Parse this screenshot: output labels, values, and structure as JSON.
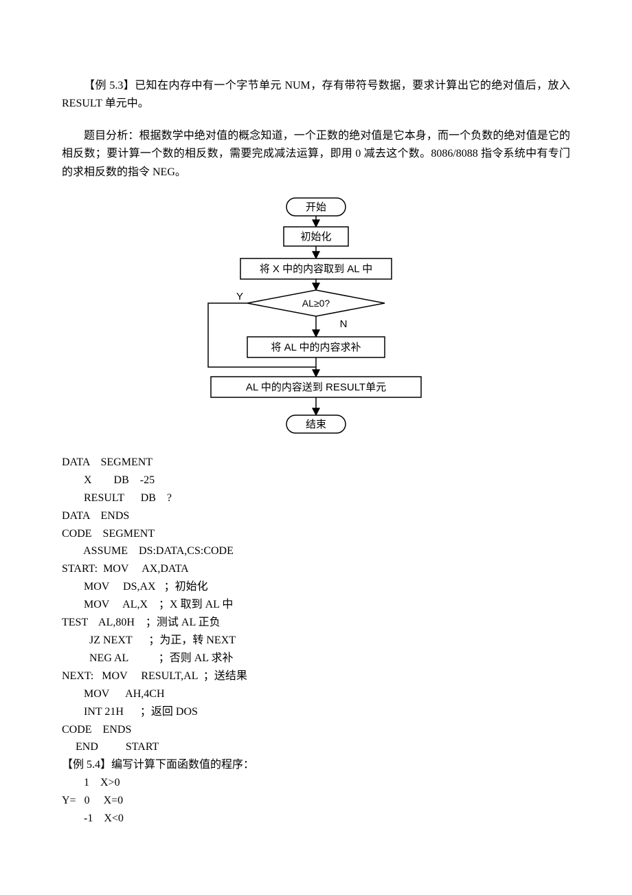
{
  "paras": {
    "p1": "【例 5.3】已知在内存中有一个字节单元 NUM，存有带符号数据，要求计算出它的绝对值后，放入 RESULT 单元中。",
    "p2": "题目分析：根据数学中绝对值的概念知道，一个正数的绝对值是它本身，而一个负数的绝对值是它的相反数；要计算一个数的相反数，需要完成减法运算，即用 0 减去这个数。8086/8088 指令系统中有专门的求相反数的指令 NEG。"
  },
  "flowchart": {
    "start": "开始",
    "init": "初始化",
    "load": "将 X 中的内容取到 AL 中",
    "test": "AL≥0?",
    "yes": "Y",
    "no": "N",
    "neg": "将 AL 中的内容求补",
    "store": "AL 中的内容送到 RESULT单元",
    "end": "结束"
  },
  "code": {
    "l01": "DATA    SEGMENT",
    "l02": "        X        DB    -25",
    "l03": "        RESULT      DB    ?",
    "l04": "DATA    ENDS",
    "l05": "CODE    SEGMENT",
    "l06": "        ASSUME    DS:DATA,CS:CODE",
    "l07": "START:  MOV     AX,DATA",
    "l08": "        MOV     DS,AX   ；初始化",
    "l09": "        MOV     AL,X    ；X 取到 AL 中",
    "l10": "TEST    AL,80H    ；测试 AL 正负",
    "l11": "          JZ NEXT      ；为正，转 NEXT",
    "l12": "          NEG AL           ；否则 AL 求补",
    "l13": "NEXT:   MOV     RESULT,AL  ；送结果",
    "l14": "        MOV      AH,4CH",
    "l15": "        INT 21H      ；返回 DOS",
    "l16": "CODE    ENDS",
    "l17": "     END          START"
  },
  "example54": {
    "title": "【例 5.4】编写计算下面函数值的程序：",
    "l1": "        1    X>0",
    "l2": "Y=   0     X=0",
    "l3": "        -1    X<0"
  }
}
